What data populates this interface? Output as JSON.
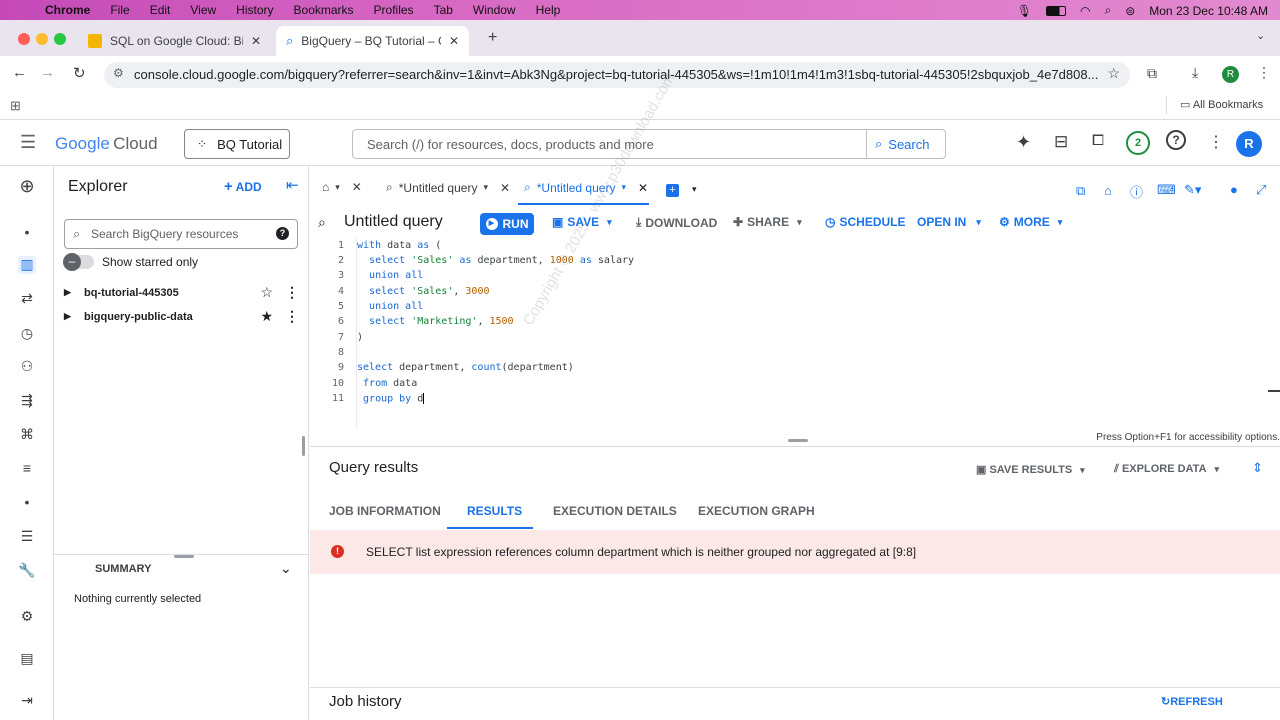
{
  "mac_menubar": {
    "app": "Chrome",
    "items": [
      "File",
      "Edit",
      "View",
      "History",
      "Bookmarks",
      "Profiles",
      "Tab",
      "Window",
      "Help"
    ],
    "clock": "Mon 23 Dec  10:48 AM"
  },
  "browser": {
    "tabs": [
      {
        "title": "SQL on Google Cloud: BigQue",
        "active": false
      },
      {
        "title": "BigQuery – BQ Tutorial – Goo",
        "active": true
      }
    ],
    "url": "console.cloud.google.com/bigquery?referrer=search&inv=1&invt=Abk3Ng&project=bq-tutorial-445305&ws=!1m10!1m4!1m3!1sbq-tutorial-445305!2sbquxjob_4e7d808...",
    "all_bookmarks": "All Bookmarks",
    "profile_initial": "R"
  },
  "gcp": {
    "logo_google": "Google",
    "logo_cloud": "Cloud",
    "project": "BQ Tutorial",
    "search_placeholder": "Search (/) for resources, docs, products and more",
    "search_button": "Search",
    "notification_count": "2",
    "avatar_initial": "R"
  },
  "explorer": {
    "title": "Explorer",
    "add_label": "ADD",
    "search_placeholder": "Search BigQuery resources",
    "starred_label": "Show starred only",
    "items": [
      {
        "label": "bq-tutorial-445305",
        "starred": false
      },
      {
        "label": "bigquery-public-data",
        "starred": true
      }
    ],
    "summary_label": "SUMMARY",
    "summary_text": "Nothing currently selected"
  },
  "editor": {
    "tabs": [
      "*Untitled query",
      "*Untitled query"
    ],
    "query_title": "Untitled query",
    "toolbar": {
      "run": "RUN",
      "save": "SAVE",
      "download": "DOWNLOAD",
      "share": "SHARE",
      "schedule": "SCHEDULE",
      "open_in": "OPEN IN",
      "more": "MORE"
    },
    "accessibility_hint": "Press Option+F1 for accessibility options."
  },
  "results": {
    "title": "Query results",
    "save_results": "SAVE RESULTS",
    "explore_data": "EXPLORE DATA",
    "tabs": [
      "JOB INFORMATION",
      "RESULTS",
      "EXECUTION DETAILS",
      "EXECUTION GRAPH"
    ],
    "active_tab": "RESULTS",
    "error": "SELECT list expression references column department which is neither grouped nor aggregated at [9:8]",
    "job_history": "Job history",
    "refresh": "REFRESH"
  },
  "watermark": "Copyright © 2025 - www.p30download.com",
  "colors": {
    "accent": "#1a73e8",
    "error_bg": "#fce8e6",
    "error_icon": "#d93025"
  }
}
